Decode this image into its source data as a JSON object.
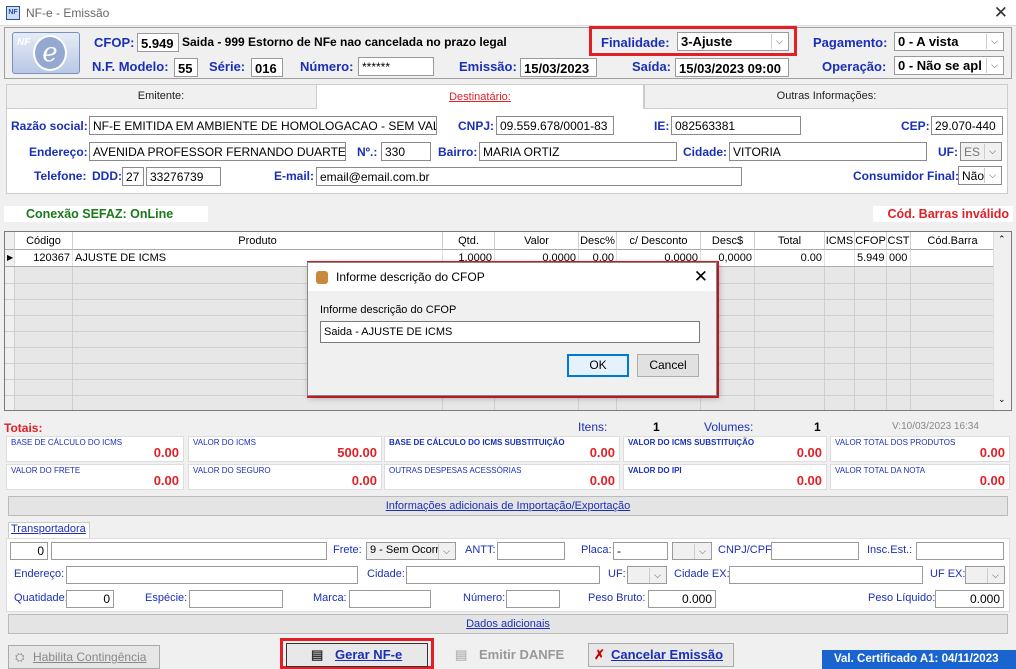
{
  "window": {
    "title": "NF-e - Emissão"
  },
  "header": {
    "cfop_label": "CFOP:",
    "cfop_value": "5.949",
    "cfop_desc": "Saida - 999 Estorno de NFe nao cancelada no prazo legal",
    "finalidade_label": "Finalidade:",
    "finalidade_value": "3-Ajuste",
    "pagamento_label": "Pagamento:",
    "pagamento_value": "0 - A vista",
    "modelo_label": "N.F. Modelo:",
    "modelo_value": "55",
    "serie_label": "Série:",
    "serie_value": "016",
    "numero_label": "Número:",
    "numero_value": "******",
    "emissao_label": "Emissão:",
    "emissao_value": "15/03/2023",
    "saida_label": "Saída:",
    "saida_value": "15/03/2023 09:00",
    "operacao_label": "Operação:",
    "operacao_value": "0 - Não se apl"
  },
  "tabs": [
    "Emitente:",
    "Destinatário:",
    "Outras Informações:"
  ],
  "destinatario": {
    "razao_label": "Razão social:",
    "razao": "NF-E EMITIDA EM AMBIENTE DE HOMOLOGACAO - SEM VALC",
    "cnpj_label": "CNPJ:",
    "cnpj": "09.559.678/0001-83",
    "ie_label": "IE:",
    "ie": "082563381",
    "cep_label": "CEP:",
    "cep": "29.070-440",
    "endereco_label": "Endereço:",
    "endereco": "AVENIDA PROFESSOR FERNANDO DUARTE",
    "numero_label": "Nº.:",
    "numero": "330",
    "bairro_label": "Bairro:",
    "bairro": "MARIA ORTIZ",
    "cidade_label": "Cidade:",
    "cidade": "VITORIA",
    "uf_label": "UF:",
    "uf": "ES",
    "telefone_label": "Telefone:",
    "ddd_label": "DDD:",
    "ddd": "27",
    "telefone": "33276739",
    "email_label": "E-mail:",
    "email": "email@email.com.br",
    "consumidor_label": "Consumidor Final:",
    "consumidor": "Não"
  },
  "status": {
    "sefaz": "Conexão SEFAZ: OnLine",
    "barras": "Cód. Barras inválido"
  },
  "grid": {
    "headers": [
      "Código",
      "Produto",
      "Qtd.",
      "Valor",
      "Desc%",
      "c/ Desconto",
      "Desc$",
      "Total",
      "ICMS",
      "CFOP",
      "CST",
      "Cód.Barra"
    ],
    "row": [
      "120367",
      "AJUSTE DE ICMS",
      "1,0000",
      "0,0000",
      "0,00",
      "0,0000",
      "0,0000",
      "0.00",
      "",
      "5.949",
      "000",
      ""
    ]
  },
  "totais": {
    "label": "Totais:",
    "itens_label": "Itens:",
    "itens": "1",
    "volumes_label": "Volumes:",
    "volumes": "1",
    "version": "V:10/03/2023 16:34",
    "cells": [
      {
        "label": "BASE DE CÁLCULO DO ICMS",
        "value": "0.00"
      },
      {
        "label": "VALOR DO ICMS",
        "value": "500.00"
      },
      {
        "label": "BASE DE CÁLCULO DO ICMS SUBSTITUIÇÃO",
        "value": "0.00"
      },
      {
        "label": "VALOR DO ICMS SUBSTITUIÇÃO",
        "value": "0.00"
      },
      {
        "label": "VALOR TOTAL DOS PRODUTOS",
        "value": "0.00"
      },
      {
        "label": "VALOR DO FRETE",
        "value": "0.00"
      },
      {
        "label": "VALOR DO SEGURO",
        "value": "0.00"
      },
      {
        "label": "OUTRAS DESPESAS ACESSÓRIAS",
        "value": "0.00"
      },
      {
        "label": "VALOR DO IPI",
        "value": "0.00"
      },
      {
        "label": "VALOR TOTAL DA NOTA",
        "value": "0.00"
      }
    ]
  },
  "info_import_btn": "Informações adicionais de Importação/Exportação",
  "transportadora": {
    "tab": "Transportadora",
    "codigo": "0",
    "frete_label": "Frete:",
    "frete": "9 - Sem Ocorr",
    "antt_label": "ANTT:",
    "placa_label": "Placa:",
    "placa": "-",
    "cnpj_label": "CNPJ/CPF:",
    "insc_label": "Insc.Est.:",
    "endereco_label": "Endereço:",
    "cidade_label": "Cidade:",
    "uf_label": "UF:",
    "cidadeex_label": "Cidade EX:",
    "ufex_label": "UF EX:",
    "quantidade_label": "Quatidade:",
    "quantidade": "0",
    "especie_label": "Espécie:",
    "marca_label": "Marca:",
    "numero_label": "Número:",
    "pesobruto_label": "Peso Bruto:",
    "pesobruto": "0.000",
    "pesoliquido_label": "Peso Líquido:",
    "pesoliquido": "0.000"
  },
  "dados_adicionais_btn": "Dados adicionais",
  "bottom": {
    "contingencia": "Habilita Contingência",
    "gerar": "Gerar NF-e",
    "danfe": "Emitir DANFE",
    "cancelar": "Cancelar Emissão",
    "certificado": "Val. Certificado A1: 04/11/2023"
  },
  "dialog": {
    "title": "Informe descrição do CFOP",
    "prompt": "Informe descrição do CFOP",
    "input": "Saida - AJUSTE DE ICMS",
    "ok": "OK",
    "cancel": "Cancel"
  }
}
